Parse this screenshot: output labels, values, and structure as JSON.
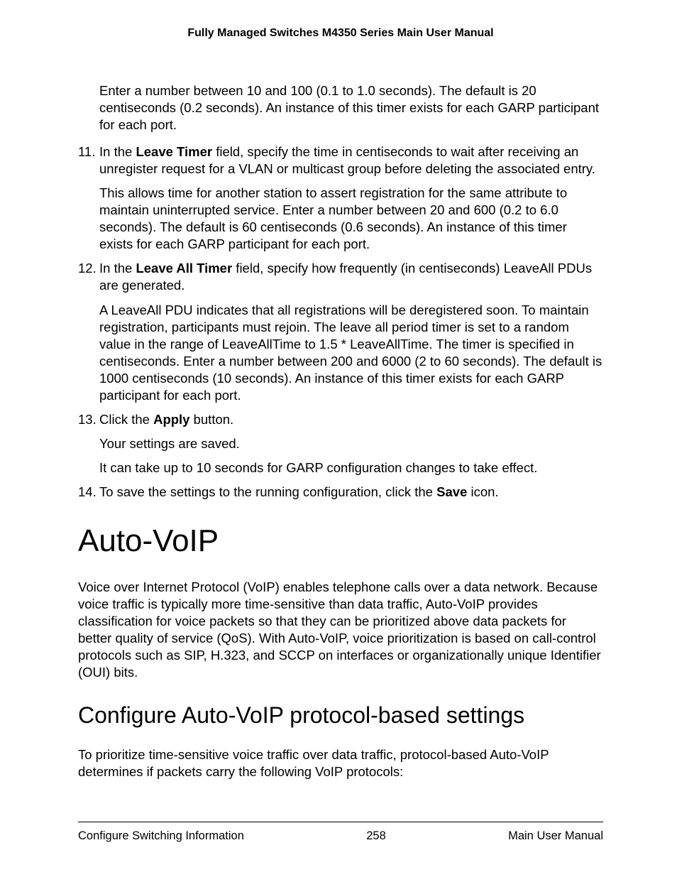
{
  "header": {
    "title": "Fully Managed Switches M4350 Series Main User Manual"
  },
  "content": {
    "p_intro": "Enter a number between 10 and 100 (0.1 to 1.0 seconds). The default is 20 centiseconds (0.2 seconds). An instance of this timer exists for each GARP participant for each port.",
    "step11": {
      "num": "11.",
      "t1": "In the ",
      "b1": "Leave Timer",
      "t2": " field, specify the time in centiseconds to wait after receiving an unregister request for a VLAN or multicast group before deleting the associated entry.",
      "sub": "This allows time for another station to assert registration for the same attribute to maintain uninterrupted service. Enter a number between 20 and 600 (0.2 to 6.0 seconds). The default is 60 centiseconds (0.6 seconds). An instance of this timer exists for each GARP participant for each port."
    },
    "step12": {
      "num": "12.",
      "t1": "In the ",
      "b1": "Leave All Timer",
      "t2": " field, specify how frequently (in centiseconds) LeaveAll PDUs are generated.",
      "sub": "A LeaveAll PDU indicates that all registrations will be deregistered soon. To maintain registration, participants must rejoin. The leave all period timer is set to a random value in the range of LeaveAllTime to 1.5 * LeaveAllTime. The timer is specified in centiseconds. Enter a number between 200 and 6000 (2 to 60 seconds). The default is 1000 centiseconds (10 seconds). An instance of this timer exists for each GARP participant for each port."
    },
    "step13": {
      "num": "13.",
      "t1": "Click the ",
      "b1": "Apply",
      "t2": " button.",
      "sub1": "Your settings are saved.",
      "sub2": "It can take up to 10 seconds for GARP configuration changes to take effect."
    },
    "step14": {
      "num": "14.",
      "t1": "To save the settings to the running configuration, click the ",
      "b1": "Save",
      "t2": " icon."
    },
    "h1": "Auto-VoIP",
    "p_autovoip": "Voice over Internet Protocol (VoIP) enables telephone calls over a data network. Because voice traffic is typically more time-sensitive than data traffic, Auto-VoIP provides classification for voice packets so that they can be prioritized above data packets for better quality of service (QoS). With Auto-VoIP, voice prioritization is based on call-control protocols such as SIP, H.323, and SCCP on interfaces or organizationally unique Identifier (OUI) bits.",
    "h2": "Configure Auto-VoIP protocol-based settings",
    "p_configure": "To prioritize time-sensitive voice traffic over data traffic, protocol-based Auto-VoIP determines if packets carry the following VoIP protocols:"
  },
  "footer": {
    "left": "Configure Switching Information",
    "center": "258",
    "right": "Main User Manual"
  }
}
